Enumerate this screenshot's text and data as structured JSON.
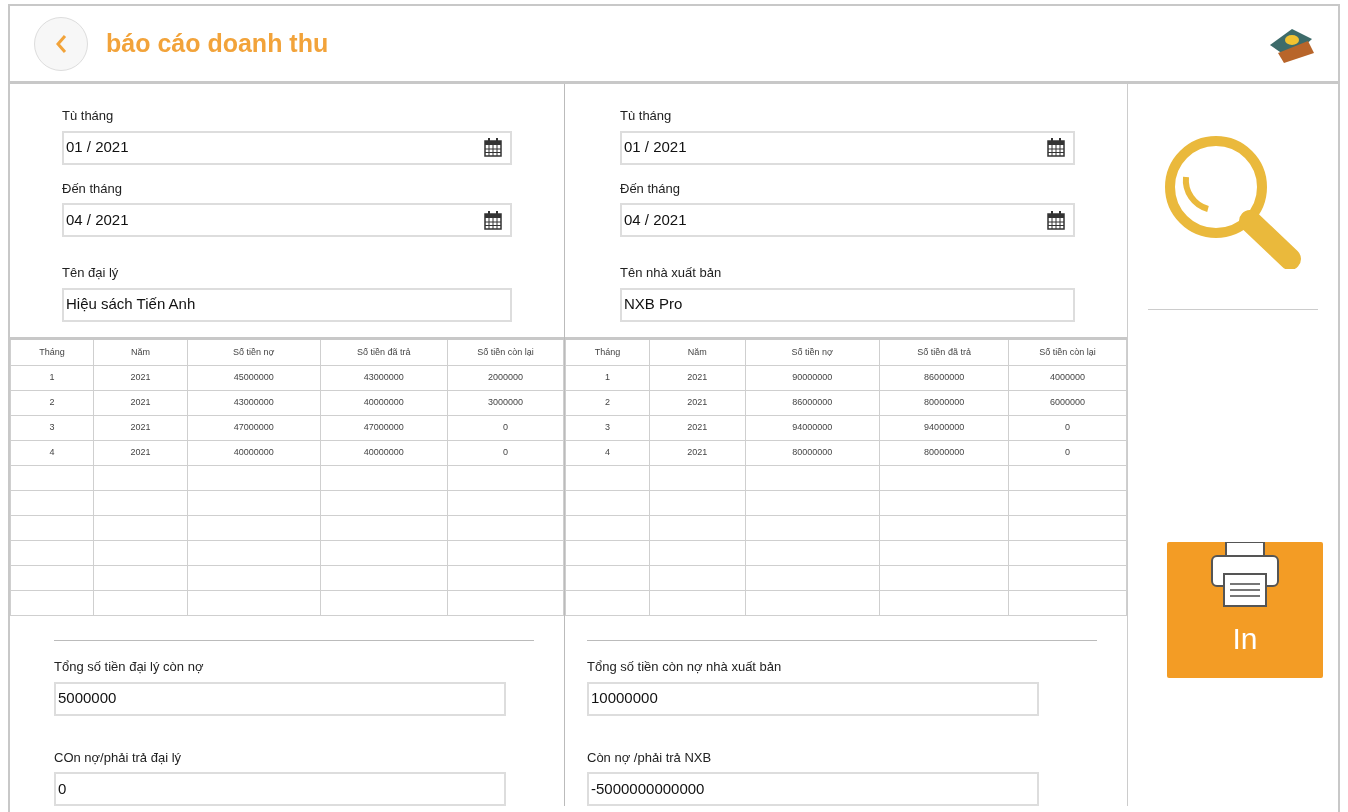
{
  "header": {
    "title": "báo cáo doanh thu"
  },
  "panels": [
    {
      "fields": [
        {
          "label": "Tù tháng",
          "value": "01 / 2021",
          "kind": "month"
        },
        {
          "label": "Đến tháng",
          "value": "04 / 2021",
          "kind": "month"
        },
        {
          "label": "Tên đại lý",
          "value": "Hiệu sách Tiến Anh",
          "kind": "text"
        }
      ],
      "table": {
        "columns": [
          "Tháng",
          "Năm",
          "Số tiền nợ",
          "Số tiền đã trả",
          "Số tiền còn lại"
        ],
        "rows": [
          [
            "1",
            "2021",
            "45000000",
            "43000000",
            "2000000"
          ],
          [
            "2",
            "2021",
            "43000000",
            "40000000",
            "3000000"
          ],
          [
            "3",
            "2021",
            "47000000",
            "47000000",
            "0"
          ],
          [
            "4",
            "2021",
            "40000000",
            "40000000",
            "0"
          ]
        ]
      },
      "summary": [
        {
          "label": "Tổng số tiền đại lý còn nợ",
          "value": "5000000"
        },
        {
          "label": "COn nợ/phải trả đại lý",
          "value": "0"
        }
      ]
    },
    {
      "fields": [
        {
          "label": "Tù tháng",
          "value": "01 / 2021",
          "kind": "month"
        },
        {
          "label": "Đến tháng",
          "value": "04 / 2021",
          "kind": "month"
        },
        {
          "label": "Tên nhà xuất bản",
          "value": "NXB Pro",
          "kind": "text"
        }
      ],
      "table": {
        "columns": [
          "Tháng",
          "Năm",
          "Số tiền nợ",
          "Số tiền đã trả",
          "Số tiền còn lại"
        ],
        "rows": [
          [
            "1",
            "2021",
            "90000000",
            "86000000",
            "4000000"
          ],
          [
            "2",
            "2021",
            "86000000",
            "80000000",
            "6000000"
          ],
          [
            "3",
            "2021",
            "94000000",
            "94000000",
            "0"
          ],
          [
            "4",
            "2021",
            "80000000",
            "80000000",
            "0"
          ]
        ]
      },
      "summary": [
        {
          "label": "Tổng số tiền còn nợ nhà xuất bản",
          "value": "10000000"
        },
        {
          "label": "Còn nợ /phải trả NXB",
          "value": "-5000000000000"
        }
      ]
    }
  ],
  "print_button": {
    "label": "In"
  }
}
